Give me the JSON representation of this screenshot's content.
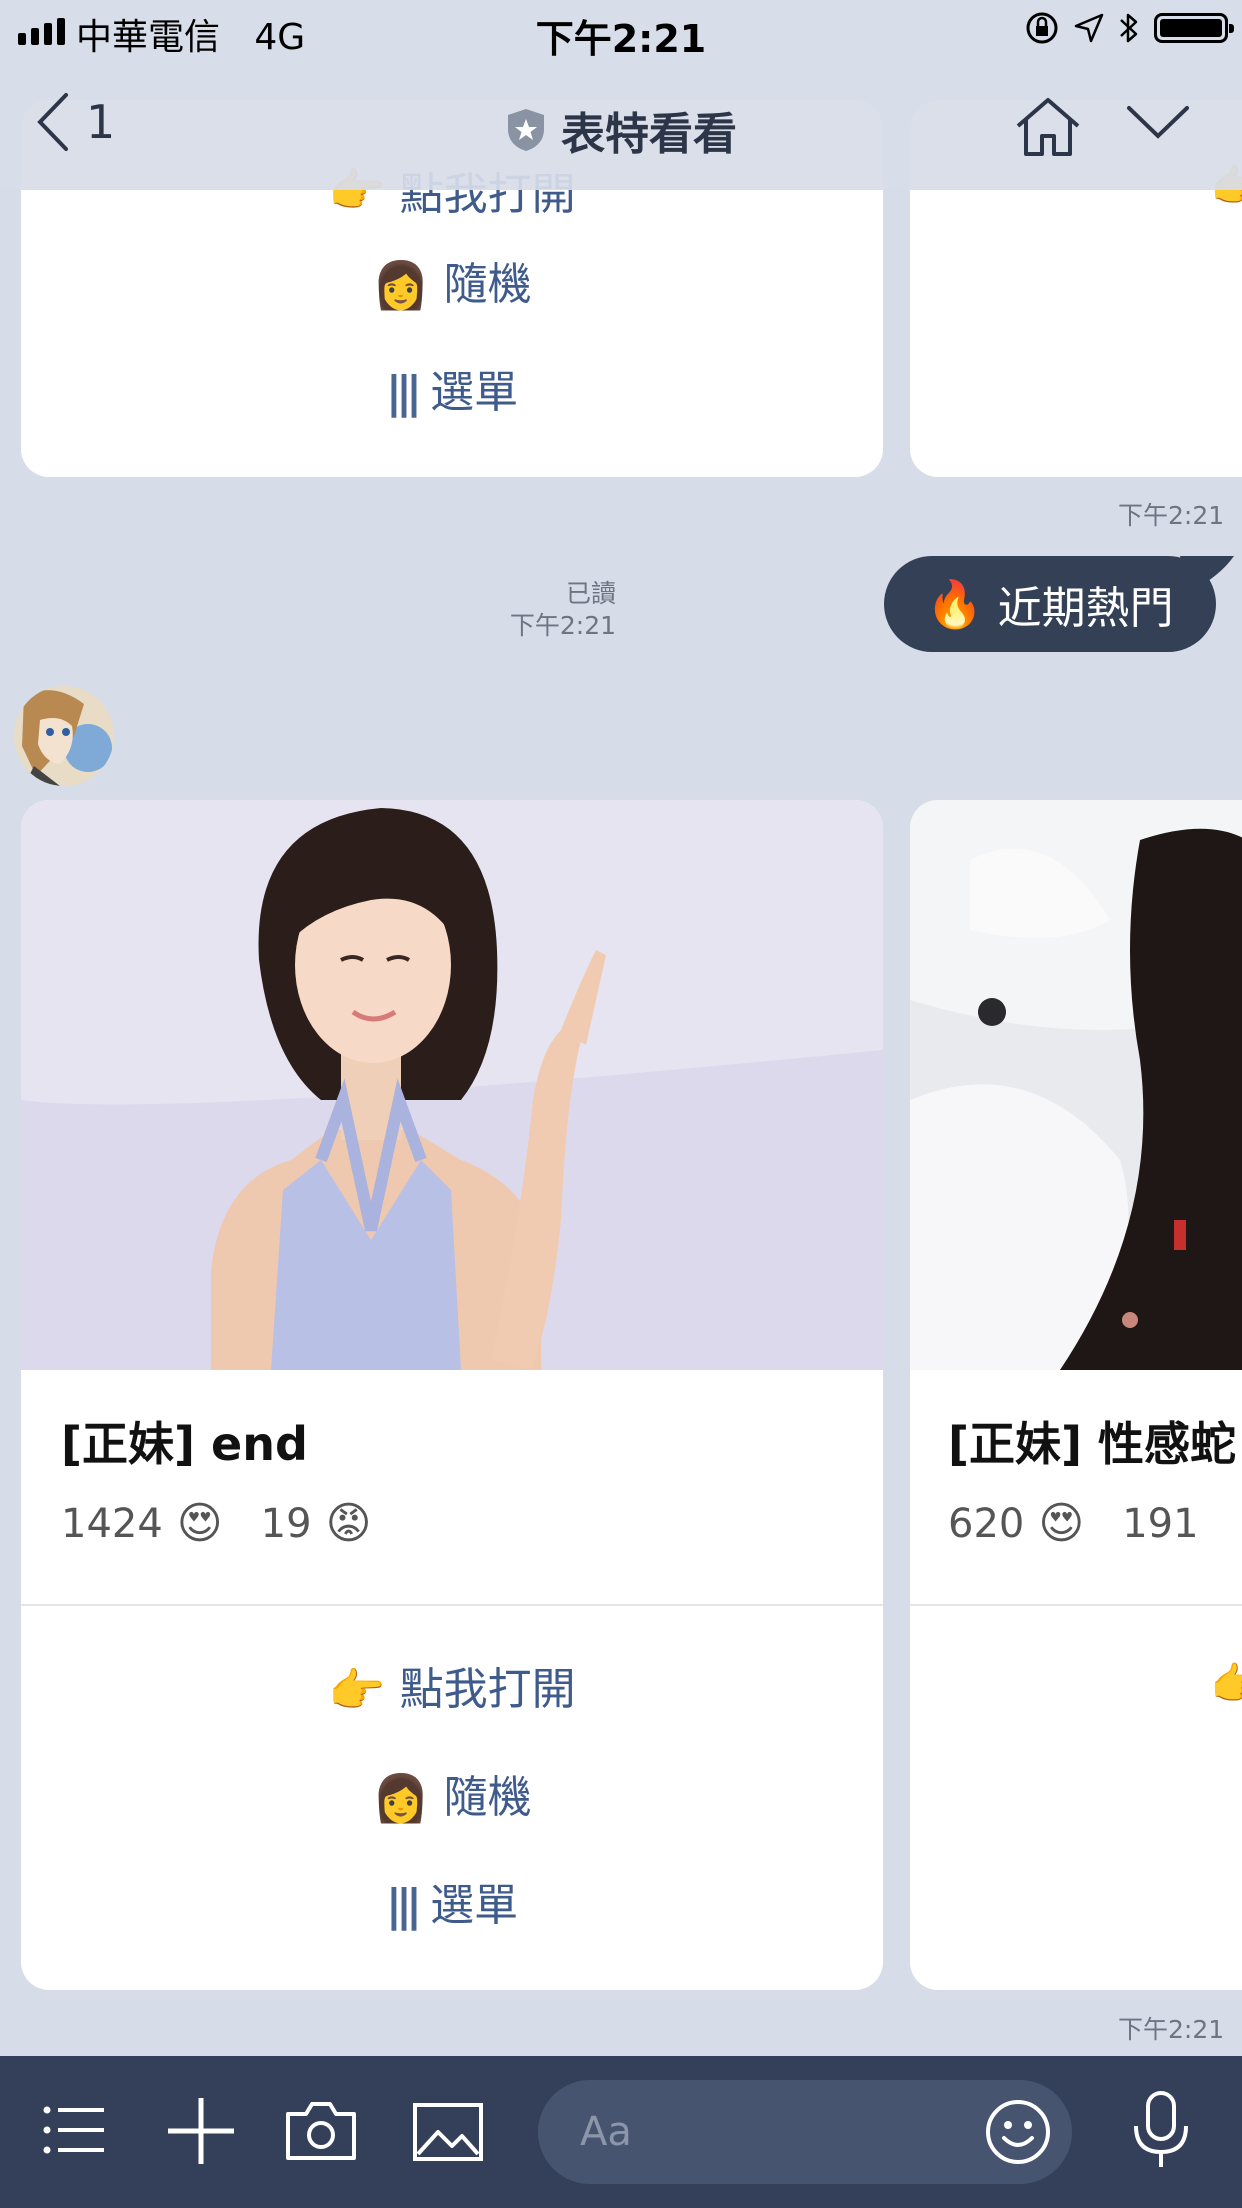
{
  "status_bar": {
    "carrier": "中華電信",
    "network": "4G",
    "time": "下午2:21"
  },
  "header": {
    "back_count": "1",
    "title": "表特看看",
    "icons": [
      "chevron-left-icon",
      "shield-star-icon",
      "home-icon",
      "chevron-down-icon"
    ]
  },
  "top_card": {
    "partial_action": "點我打開",
    "actions": [
      {
        "emoji": "👩",
        "label": "隨機"
      },
      {
        "emoji": "|||",
        "label": "選單"
      }
    ]
  },
  "time_1": "下午2:21",
  "sent_message": {
    "read_label": "已讀",
    "time": "下午2:21",
    "emoji": "🔥",
    "text": "近期熱門"
  },
  "cards": [
    {
      "title": "[正妹] end",
      "likes": "1424",
      "like_emoji": "😍",
      "dislikes": "19",
      "dislike_emoji": "😡",
      "actions": [
        {
          "emoji": "👉",
          "label": "點我打開"
        },
        {
          "emoji": "👩",
          "label": "隨機"
        },
        {
          "emoji": "|||",
          "label": "選單"
        }
      ]
    },
    {
      "title": "[正妹] 性感蛇",
      "likes": "620",
      "like_emoji": "😍",
      "dislikes": "191"
    }
  ],
  "time_2": "下午2:21",
  "toolbar": {
    "input_placeholder": "Aa",
    "icons": [
      "menu-icon",
      "plus-icon",
      "camera-icon",
      "image-icon",
      "emoji-icon",
      "microphone-icon"
    ]
  },
  "colors": {
    "background": "#d7dde8",
    "toolbar": "#344059",
    "bubble": "#334056",
    "action_text": "#3e5b8c"
  }
}
